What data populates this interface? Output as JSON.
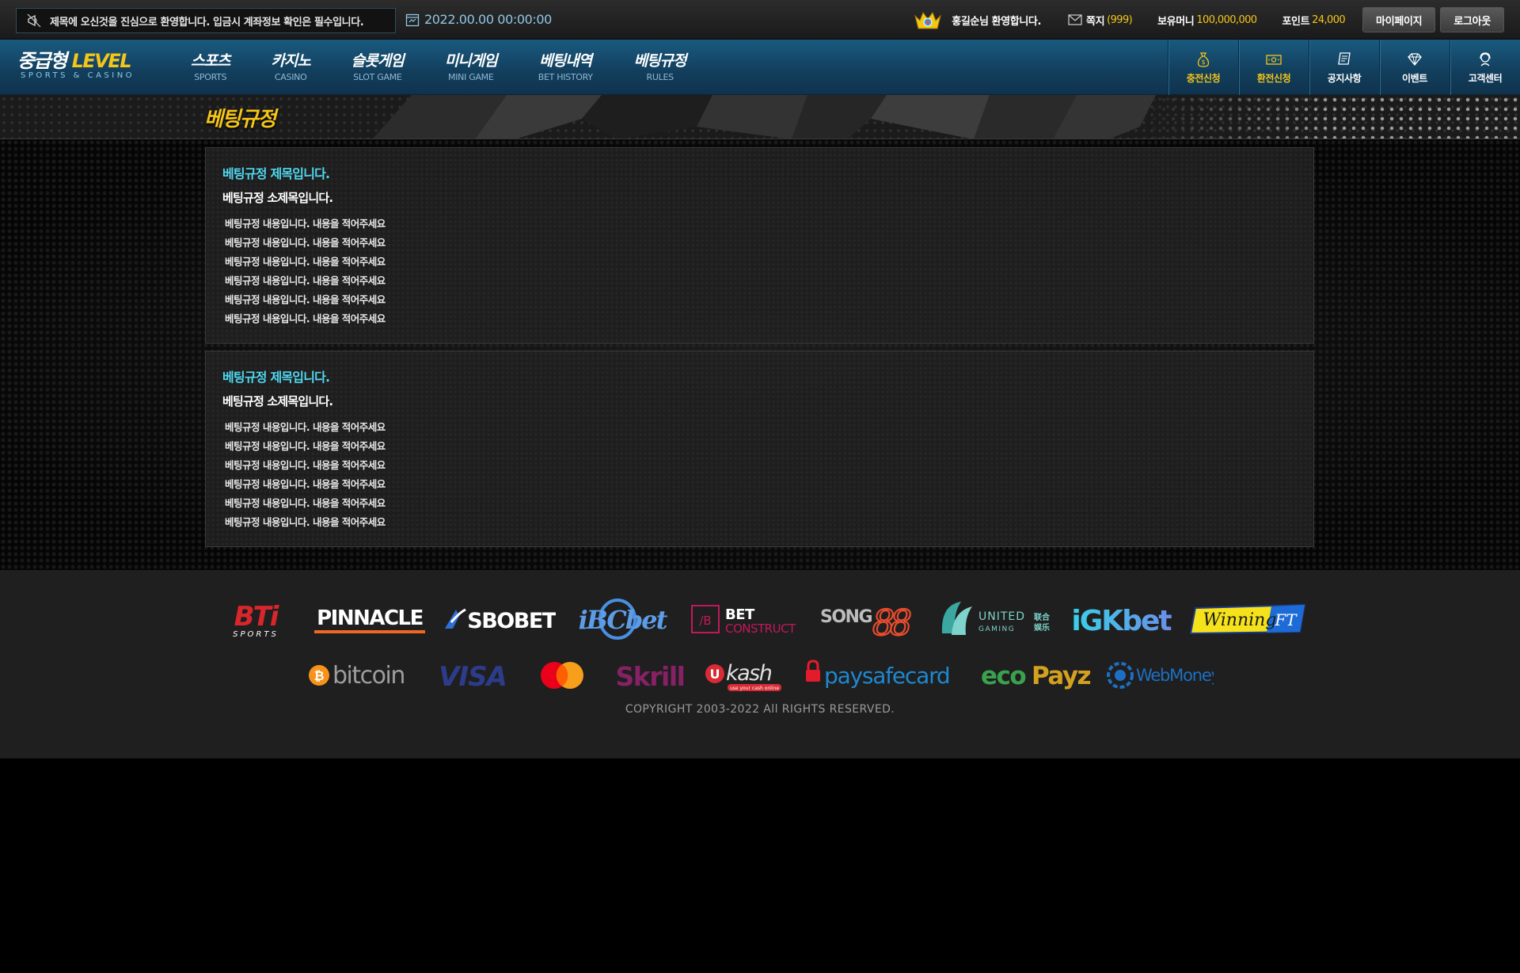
{
  "topbar": {
    "notice": "제목에 오신것을 진심으로 환영합니다. 입금시 계좌정보 확인은 필수입니다.",
    "datetime": "2022.00.00  00:00:00",
    "welcome": "홍길순님 환영합니다.",
    "mail_label": "쪽지",
    "mail_count": "(999)",
    "money_label": "보유머니",
    "money_value": "100,000,000",
    "point_label": "포인트",
    "point_value": "24,000",
    "mypage_label": "마이페이지",
    "logout_label": "로그아웃"
  },
  "nav": {
    "logo_kr": "중급형",
    "logo_level": "LEVEL",
    "logo_sub": "SPORTS & CASINO",
    "menu": [
      {
        "kr": "스포츠",
        "en": "SPORTS"
      },
      {
        "kr": "카지노",
        "en": "CASINO"
      },
      {
        "kr": "슬롯게임",
        "en": "SLOT GAME"
      },
      {
        "kr": "미니게임",
        "en": "MINI GAME"
      },
      {
        "kr": "베팅내역",
        "en": "BET HISTORY"
      },
      {
        "kr": "베팅규정",
        "en": "RULES"
      }
    ],
    "quick": [
      {
        "label": "충전신청",
        "icon": "money-bag-icon"
      },
      {
        "label": "환전신청",
        "icon": "cash-icon"
      },
      {
        "label": "공지사항",
        "icon": "notice-board-icon"
      },
      {
        "label": "이벤트",
        "icon": "diamond-icon"
      },
      {
        "label": "고객센터",
        "icon": "support-icon"
      }
    ],
    "accent_color": "#f5c518"
  },
  "page": {
    "title": "베팅규정"
  },
  "rules": [
    {
      "title": "베팅규정 제목입니다.",
      "subtitle": "베팅규정 소제목입니다.",
      "lines": [
        "베팅규정 내용입니다. 내용을 적어주세요",
        "베팅규정 내용입니다. 내용을 적어주세요",
        "베팅규정 내용입니다. 내용을 적어주세요",
        "베팅규정 내용입니다. 내용을 적어주세요",
        "베팅규정 내용입니다. 내용을 적어주세요",
        "베팅규정 내용입니다. 내용을 적어주세요"
      ]
    },
    {
      "title": "베팅규정 제목입니다.",
      "subtitle": "베팅규정 소제목입니다.",
      "lines": [
        "베팅규정 내용입니다. 내용을 적어주세요",
        "베팅규정 내용입니다. 내용을 적어주세요",
        "베팅규정 내용입니다. 내용을 적어주세요",
        "베팅규정 내용입니다. 내용을 적어주세요",
        "베팅규정 내용입니다. 내용을 적어주세요",
        "베팅규정 내용입니다. 내용을 적어주세요"
      ]
    }
  ],
  "footer": {
    "provider_logos": [
      "BTi SPORTS",
      "PINNACLE",
      "SBOBET",
      "iBCbet",
      "BET CONSTRUCT",
      "SONG88",
      "UNITED GAMING 联合娱乐",
      "iGKbet",
      "WinningFT"
    ],
    "payment_logos": [
      "bitcoin",
      "VISA",
      "mastercard",
      "Skrill",
      "ukash use your cash online",
      "paysafecard",
      "ecoPayz",
      "WebMoney"
    ],
    "copyright": "COPYRIGHT 2003-2022 All RIGHTS RESERVED."
  }
}
